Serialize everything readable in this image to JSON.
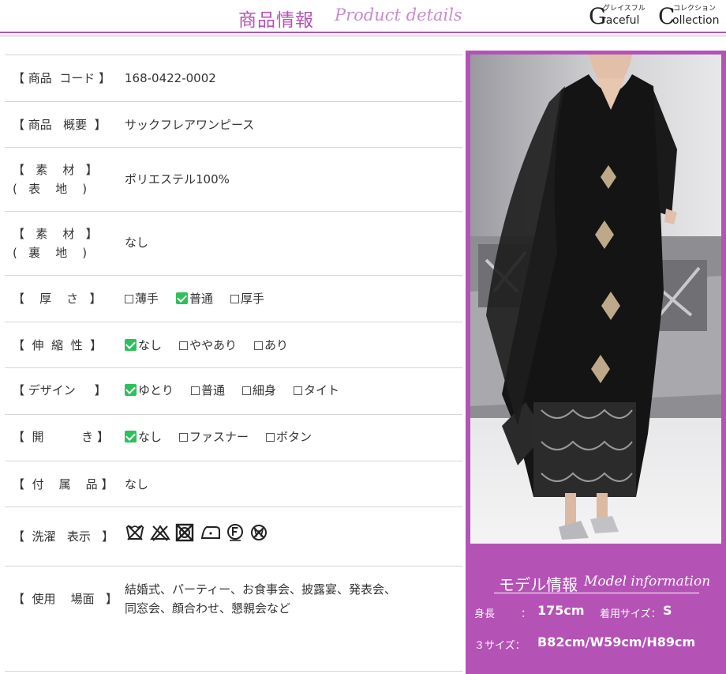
{
  "header": {
    "title_jp": "商品情報",
    "title_en": "Product details",
    "brand": {
      "kana_g": "グレイスフル",
      "kana_c": "コレクション",
      "initial_g": "G",
      "word_g": "raceful",
      "initial_c": "C",
      "word_c": "ollection"
    }
  },
  "specs": {
    "code_label": "【 商品  コード 】",
    "code_value": "168-0422-0002",
    "summary_label": "【 商品   概要  】",
    "summary_value": "サックフレアワンピース",
    "material_outer_label": "【   素    材   】\n(   表    地    )",
    "material_outer_value": "ポリエステル100%",
    "material_lining_label": "【   素    材   】\n(   裏    地    )",
    "material_lining_value": "なし",
    "thickness_label": "【    厚    さ   】",
    "thickness_opt1": "薄手",
    "thickness_opt2": "普通",
    "thickness_opt3": "厚手",
    "stretch_label": "【  伸  縮  性  】",
    "stretch_opt1": "なし",
    "stretch_opt2": "ややあり",
    "stretch_opt3": "あり",
    "design_label": "【 デザイン     】",
    "design_opt1": "ゆとり",
    "design_opt2": "普通",
    "design_opt3": "細身",
    "design_opt4": "タイト",
    "opening_label": "【  開          き 】",
    "opening_opt1": "なし",
    "opening_opt2": "ファスナー",
    "opening_opt3": "ボタン",
    "accessories_label": "【  付    属    品 】",
    "accessories_value": "なし",
    "washing_label": "【  洗濯   表示   】",
    "usage_label": "【  使用    場面   】",
    "usage_line1": "結婚式、パーティー、お食事会、披露宴、発表会、",
    "usage_line2": "同窓会、顔合わせ、懇親会など"
  },
  "model": {
    "title_jp": "モデル情報",
    "title_en": "Model information",
    "height_label": "身長",
    "height_colon": "：",
    "height_value": "175cm",
    "size_label": "着用サイズ：",
    "size_value": "S",
    "three_size_label": "３サイズ：",
    "three_size_value": "B82cm/W59cm/H89cm"
  },
  "colors": {
    "accent": "#b552b6",
    "check": "#2ec05b",
    "rule": "#d6d6d6"
  }
}
